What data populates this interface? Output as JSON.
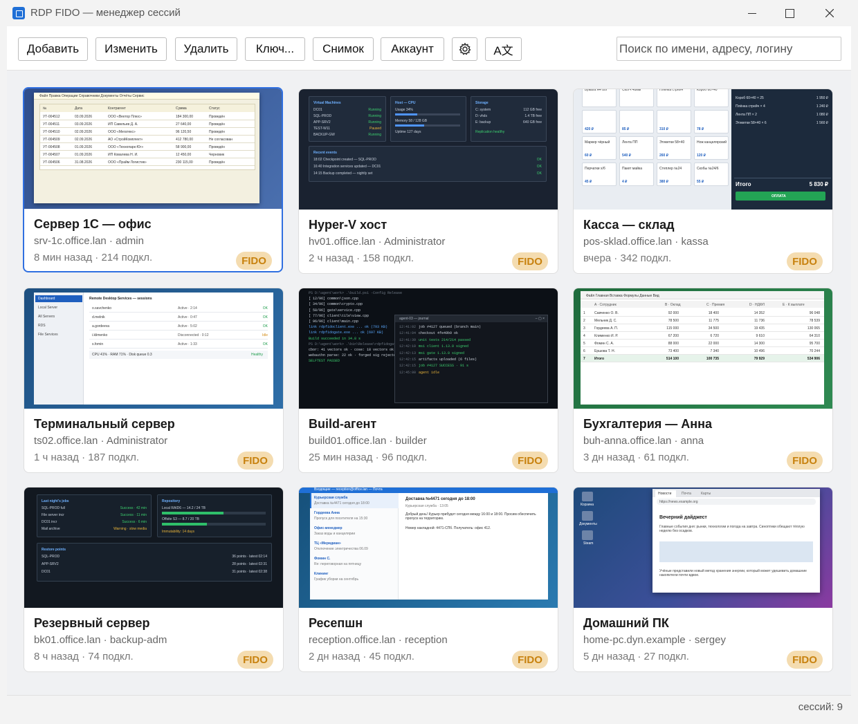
{
  "window": {
    "title": "RDP FIDO — менеджер сессий"
  },
  "toolbar": {
    "add": "Добавить",
    "edit": "Изменить",
    "delete": "Удалить",
    "key": "Ключ...",
    "snapshot": "Снимок",
    "account": "Аккаунт",
    "lang_icon": "A文",
    "search_placeholder": "Поиск по имени, адресу, логину"
  },
  "badge_label": "FIDO",
  "cards": [
    {
      "name": "Сервер 1С — офис",
      "host": "srv-1c.office.lan",
      "user": "admin",
      "ago": "8 мин назад",
      "conn": "214 подкл.",
      "selected": true
    },
    {
      "name": "Hyper-V хост",
      "host": "hv01.office.lan",
      "user": "Administrator",
      "ago": "2 ч назад",
      "conn": "158 подкл."
    },
    {
      "name": "Касса — склад",
      "host": "pos-sklad.office.lan",
      "user": "kassa",
      "ago": "вчера",
      "conn": "342 подкл."
    },
    {
      "name": "Терминальный сервер",
      "host": "ts02.office.lan",
      "user": "Administrator",
      "ago": "1 ч назад",
      "conn": "187 подкл."
    },
    {
      "name": "Build-агент",
      "host": "build01.office.lan",
      "user": "builder",
      "ago": "25 мин назад",
      "conn": "96 подкл."
    },
    {
      "name": "Бухгалтерия — Анна",
      "host": "buh-anna.office.lan",
      "user": "anna",
      "ago": "3 дн назад",
      "conn": "61 подкл."
    },
    {
      "name": "Резервный сервер",
      "host": "bk01.office.lan",
      "user": "backup-adm",
      "ago": "8 ч назад",
      "conn": "74 подкл."
    },
    {
      "name": "Ресепшн",
      "host": "reception.office.lan",
      "user": "reception",
      "ago": "2 дн назад",
      "conn": "45 подкл."
    },
    {
      "name": "Домашний ПК",
      "host": "home-pc.dyn.example",
      "user": "sergey",
      "ago": "5 дн назад",
      "conn": "27 подкл."
    }
  ],
  "thumbs": {
    "t1": {
      "menu": "Файл   Правка   Операции   Справочники   Документы   Отчёты   Сервис",
      "headers": [
        "№",
        "Дата",
        "Контрагент",
        "Сумма",
        "Статус"
      ],
      "rows": [
        [
          "УТ-004512",
          "03.09.2026",
          "ООО «Вектор Плюс»",
          "184 300,00",
          "Проведён"
        ],
        [
          "УТ-004511",
          "03.09.2026",
          "ИП Савельев Д. А.",
          "27 640,00",
          "Проведён"
        ],
        [
          "УТ-004510",
          "02.09.2026",
          "ООО «Мегатекс»",
          "96 120,50",
          "Проведён"
        ],
        [
          "УТ-004509",
          "02.09.2026",
          "АО «СтройКомплект»",
          "412 780,00",
          "Не согласован"
        ],
        [
          "УТ-004508",
          "01.09.2026",
          "ООО «Технопарк-Юг»",
          "58 900,00",
          "Проведён"
        ],
        [
          "УТ-004507",
          "01.09.2026",
          "ИП Ковалева Н. И.",
          "12 450,00",
          "Черновик"
        ],
        [
          "УТ-004506",
          "31.08.2026",
          "ООО «Прайм Логистик»",
          "230 115,00",
          "Проведён"
        ]
      ]
    },
    "t2": {
      "vm_title": "Virtual Machines",
      "vms": [
        [
          "DC01",
          "Running"
        ],
        [
          "SQL-PROD",
          "Running"
        ],
        [
          "APP-SRV2",
          "Running"
        ],
        [
          "TEST-W11",
          "Paused"
        ],
        [
          "BACKUP-GW",
          "Running"
        ]
      ],
      "host_title": "Host — CPU",
      "cpu": "Usage 34%",
      "cpu_level": 0.34,
      "mem": "Memory 58 / 128 GB",
      "mem_level": 0.45,
      "uptime": "Uptime 127 days",
      "storage_title": "Storage",
      "storage": [
        [
          "C: system",
          "112 GB free"
        ],
        [
          "D: vhds",
          "1.4 TB free"
        ],
        [
          "E: backup",
          "640 GB free"
        ]
      ],
      "replication": "Replication healthy",
      "events_title": "Recent events",
      "events": [
        [
          "18:02 Checkpoint created — SQL-PROD",
          "OK"
        ],
        [
          "16:40 Integration services updated — DC01",
          "OK"
        ],
        [
          "14:15 Backup completed — nightly set",
          "OK"
        ]
      ]
    },
    "t3": {
      "tiles": [
        [
          "Бумага А4 80г",
          ""
        ],
        [
          "Скотч 48мм",
          ""
        ],
        [
          "Плёнка стрейч",
          ""
        ],
        [
          "Короб 60×40",
          ""
        ],
        [
          "",
          "420 ₽"
        ],
        [
          "",
          "85 ₽"
        ],
        [
          "",
          "310 ₽"
        ],
        [
          "",
          "78 ₽"
        ],
        [
          "Маркер чёрный",
          "60 ₽"
        ],
        [
          "Лента ПП",
          "540 ₽"
        ],
        [
          "Этикетки 58×40",
          "260 ₽"
        ],
        [
          "Нож канцелярский",
          "120 ₽"
        ],
        [
          "Перчатки х/б",
          "45 ₽"
        ],
        [
          "Пакет майка",
          "4 ₽"
        ],
        [
          "Степлер №24",
          "380 ₽"
        ],
        [
          "Скобы №24/6",
          "55 ₽"
        ]
      ],
      "cart": [
        [
          "Короб 60×40 × 25",
          "1 950 ₽"
        ],
        [
          "Плёнка стрейч × 4",
          "1 240 ₽"
        ],
        [
          "Лента ПП × 2",
          "1 080 ₽"
        ],
        [
          "Этикетки 58×40 × 6",
          "1 560 ₽"
        ]
      ],
      "total_label": "Итого",
      "total": "5 830 ₽",
      "pay": "ОПЛАТА"
    },
    "t4": {
      "nav": [
        "Dashboard",
        "Local Server",
        "All Servers",
        "RDS",
        "File Services"
      ],
      "title": "Remote Desktop Services — sessions",
      "rows": [
        [
          "o.savchenko",
          "Active · 2:14",
          "OK"
        ],
        [
          "d.melnik",
          "Active · 0:47",
          "OK"
        ],
        [
          "a.gordeeva",
          "Active · 5:02",
          "OK"
        ],
        [
          "i.klimenko",
          "Disconnected · 0:12",
          "Idle"
        ],
        [
          "s.fomin",
          "Active · 1:33",
          "OK"
        ]
      ],
      "footer": "CPU 41% · RAM 71% · Disk queue 0.3",
      "footer_status": "Healthy"
    },
    "t5": {
      "lines": [
        "PS D:\\agent\\work> .\\build.ps1 -Config Release",
        "[ 12/96] common\\json.cpp",
        "[ 34/96] common\\crypto.cpp",
        "[ 58/96] gate\\service.cpp",
        "[ 77/96] client\\tile\\view.cpp",
        "[ 96/96] client\\main.cpp",
        "link rdpfidoclient.exe ... ok (793 KB)",
        "link rdpfidogate.exe ... ok (697 KB)",
        "Build succeeded in 34.8 s",
        "PS D:\\agent\\work> .\\bin\\Release\\rdpfidogate",
        "cbor: 41 vectors ok · cose: 18 vectors ok",
        "webauthn parse: 22 ok · forged sig rejected",
        "SELFTEST PASSED"
      ],
      "journal_title": "agent-03 — journal",
      "journal": [
        [
          "12:41:02",
          "job #4127 queued (branch main)"
        ],
        [
          "12:41:04",
          "checkout 4fe49b9 ok"
        ],
        [
          "12:41:39",
          "unit tests 214/214 passed"
        ],
        [
          "12:42:10",
          "msi client 1.13.0 signed"
        ],
        [
          "12:42:13",
          "msi gate 1.13.0 signed"
        ],
        [
          "12:42:15",
          "artifacts uploaded (6 files)"
        ],
        [
          "12:42:15",
          "job #4127 SUCCESS · 91 s"
        ],
        [
          "12:45:00",
          "agent idle"
        ]
      ]
    },
    "t6": {
      "menu": "Файл   Главная   Вставка   Формулы   Данные   Вид",
      "headers": [
        "A · Сотрудник",
        "B · Оклад",
        "C · Премия",
        "D · НДФЛ",
        "E · К выплате"
      ],
      "rows": [
        [
          "1",
          "Савченко О. В.",
          "92 000",
          "18 400",
          "14 352",
          "96 048"
        ],
        [
          "2",
          "Мельник Д. С.",
          "78 500",
          "11 775",
          "11 736",
          "78 539"
        ],
        [
          "3",
          "Гордеева А. П.",
          "115 000",
          "34 500",
          "19 435",
          "130 065"
        ],
        [
          "4",
          "Клименко И. Р.",
          "67 200",
          "6 720",
          "9 610",
          "64 310"
        ],
        [
          "5",
          "Фомин С. А.",
          "88 000",
          "22 000",
          "14 300",
          "95 700"
        ],
        [
          "6",
          "Ершова Т. Н.",
          "73 400",
          "7 340",
          "10 496",
          "70 244"
        ],
        [
          "7",
          "Итого",
          "514 100",
          "100 735",
          "79 929",
          "534 906"
        ]
      ]
    },
    "t7": {
      "jobs_title": "Last night's jobs",
      "jobs": [
        [
          "SQL-PROD full",
          "Success · 42 min"
        ],
        [
          "File server incr",
          "Success · 11 min"
        ],
        [
          "DC01 incr",
          "Success · 6 min"
        ],
        [
          "Mail archive",
          "Warning · slow media"
        ]
      ],
      "repo_title": "Repository",
      "repo1": "Local RAID6 — 14.2 / 24 TB",
      "repo1_level": 0.59,
      "repo2": "Offsite S3 — 8.7 / 20 TB",
      "repo2_level": 0.43,
      "immut": "Immutability: 14 days",
      "rp_title": "Restore points",
      "rps": [
        [
          "SQL-PROD",
          "36 points · latest 02:14"
        ],
        [
          "APP-SRV2",
          "28 points · latest 02:31"
        ],
        [
          "DC01",
          "31 points · latest 02:38"
        ]
      ]
    },
    "t8": {
      "topbar": "Входящие — reception@office.lan — Почта",
      "mails": [
        [
          "Курьерская служба",
          "Доставка №4471 сегодня до 18:00"
        ],
        [
          "Гордеева Анна",
          "Пропуск для посетителя на 15:30"
        ],
        [
          "Офис-менеджер",
          "Заказ воды и канцелярии"
        ],
        [
          "ТЦ «Меридиан»",
          "Отключение электричества 06.09"
        ],
        [
          "Фомин С.",
          "Re: переговорная на пятницу"
        ],
        [
          "Клининг",
          "График уборки на сентябрь"
        ]
      ],
      "subject": "Доставка №4471 сегодня до 18:00",
      "from": "Курьерская служба · 13:05",
      "body": "Добрый день! Курьер прибудет сегодня между 16:00 и 18:00. Просим обеспечить пропуск на территорию.",
      "note": "Номер накладной: 4471-СПб. Получатель: офис 412."
    },
    "t9": {
      "desktop": [
        "Корзина",
        "Документы",
        "Steam"
      ],
      "tabs": [
        "Новости",
        "Почта",
        "Карты"
      ],
      "url": "https://news.example.org",
      "title": "Вечерний дайджест",
      "lead": "Главные события дня: рынки, технологии и погода на завтра. Синоптики обещают тёплую неделю без осадков.",
      "text": "Учёные представили новый метод хранения энергии, который может удешевить домашние накопители почти вдвое."
    }
  },
  "status": {
    "sessions": "сессий: 9"
  },
  "colors": {
    "accent": "#2f6fe0",
    "badge_bg": "#f4dcb0",
    "badge_fg": "#c8820f"
  },
  "icons": {
    "settings": "gear-icon",
    "language": "translate-icon"
  }
}
